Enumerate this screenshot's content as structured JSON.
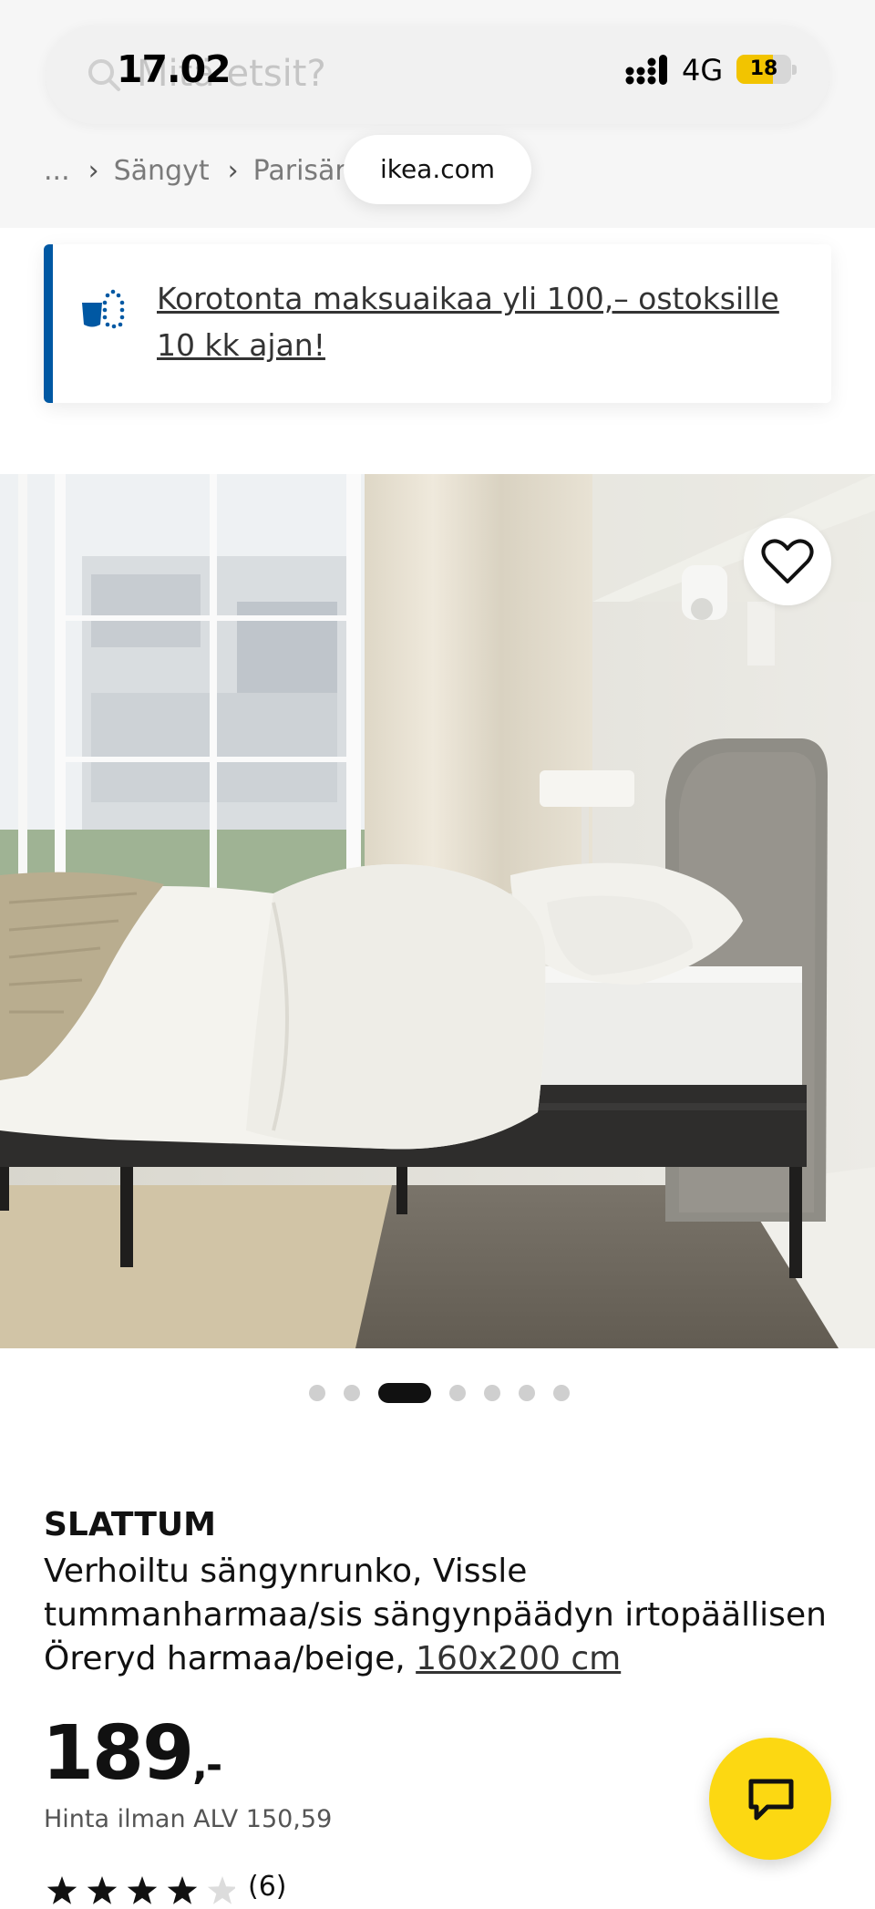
{
  "status_bar": {
    "time": "17.02",
    "network": "4G",
    "battery_level": "18",
    "battery_fraction": 0.18
  },
  "search": {
    "placeholder": "Mitä etsit?"
  },
  "breadcrumb": {
    "items": [
      "...",
      "Sängyt",
      "Parisäng"
    ],
    "url": "ikea.com"
  },
  "banner": {
    "text": "Korotonta maksuaikaa yli 100,– ostoksille 10 kk ajan!",
    "accent": "#0058a3"
  },
  "gallery": {
    "slide_count": 7,
    "active_index": 2
  },
  "product": {
    "brand": "SLATTUM",
    "description": "Verhoiltu sängynrunko, Vissle tummanharmaa/sis sängynpäädyn irtopäällisen Öreryd harmaa/beige, ",
    "size": "160x200 cm",
    "price": "189",
    "price_suffix": ",-",
    "vat_text": "Hinta ilman ALV 150,59",
    "rating": 4,
    "rating_max": 5,
    "review_count": "(6)"
  },
  "icons": {
    "search": "search-icon",
    "favourite": "heart-icon",
    "chat": "chat-icon",
    "banner": "payment-icon"
  },
  "colors": {
    "chat_button": "#fcd812",
    "text": "#111111"
  }
}
